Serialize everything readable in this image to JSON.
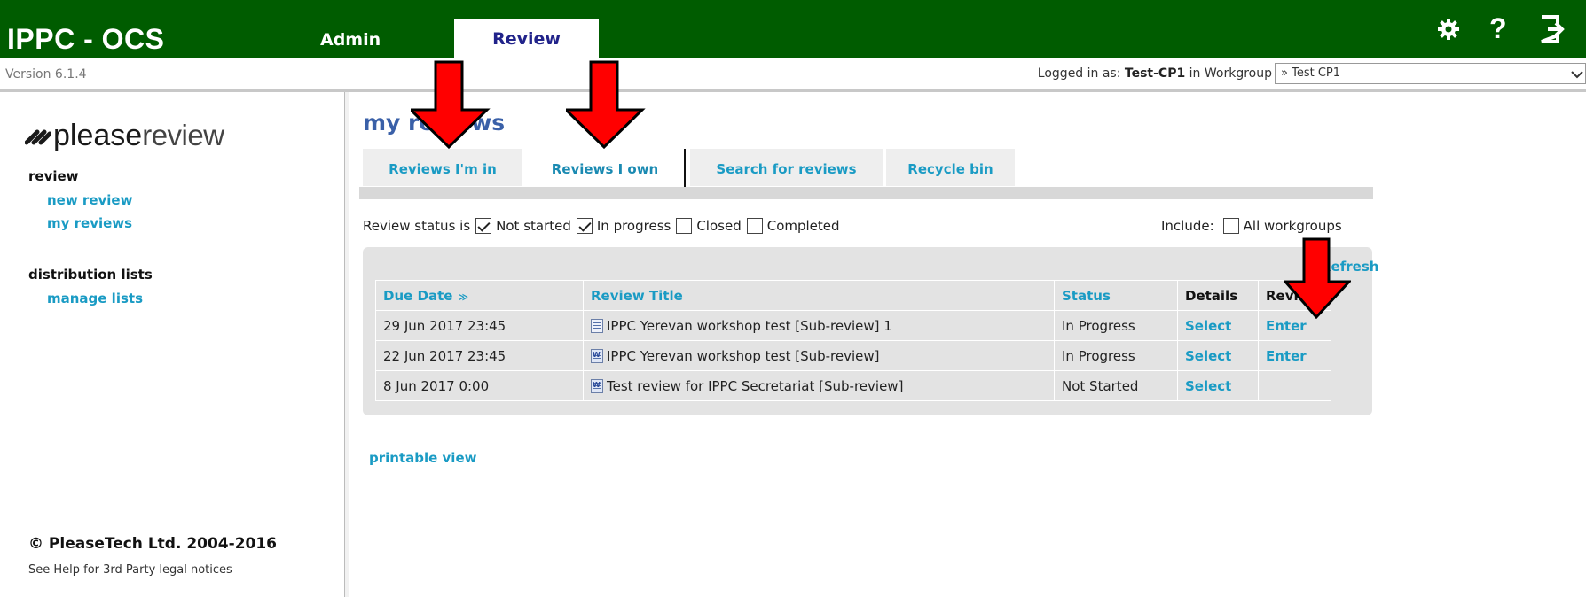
{
  "header": {
    "app_title": "IPPC - OCS",
    "nav": [
      {
        "label": "Admin",
        "active": false
      },
      {
        "label": "Review",
        "active": true
      }
    ],
    "icons": [
      "gear-icon",
      "help-icon",
      "logout-icon"
    ],
    "help_glyph": "?"
  },
  "subbar": {
    "version": "Version 6.1.4",
    "logged_in_prefix": "Logged in as: ",
    "logged_in_user": "Test-CP1",
    "workgroup_prefix": " in Workgroup",
    "workgroup_value": "» Test CP1"
  },
  "sidebar": {
    "logo_please": "please",
    "logo_review": "review",
    "sections": [
      {
        "heading": "review",
        "links": [
          "new review",
          "my reviews"
        ]
      },
      {
        "heading": "distribution lists",
        "links": [
          "manage lists"
        ]
      }
    ],
    "copyright": "© PleaseTech Ltd. 2004-2016",
    "legal": "See Help for 3rd Party legal notices"
  },
  "main": {
    "title": "my reviews",
    "tabs": [
      {
        "label": "Reviews I'm in",
        "active": false
      },
      {
        "label": "Reviews I own",
        "active": true
      },
      {
        "label": "Search for reviews",
        "active": false
      },
      {
        "label": "Recycle bin",
        "active": false
      }
    ],
    "status_label": "Review status is",
    "status_filters": [
      {
        "label": "Not started",
        "checked": true
      },
      {
        "label": "In progress",
        "checked": true
      },
      {
        "label": "Closed",
        "checked": false
      },
      {
        "label": "Completed",
        "checked": false
      }
    ],
    "include_label": "Include:",
    "include_option": {
      "label": "All workgroups",
      "checked": false
    },
    "refresh_label": "Refresh",
    "table": {
      "columns": [
        "Due Date",
        "Review Title",
        "Status",
        "Details",
        "Review"
      ],
      "rows": [
        {
          "due": "29 Jun 2017 23:45",
          "icon": "document-folder-icon",
          "title": "IPPC Yerevan workshop test [Sub-review] 1",
          "status": "In Progress",
          "details": "Select",
          "review": "Enter"
        },
        {
          "due": "22 Jun 2017 23:45",
          "icon": "word-document-icon",
          "title": "IPPC Yerevan workshop test [Sub-review]",
          "status": "In Progress",
          "details": "Select",
          "review": "Enter"
        },
        {
          "due": "8 Jun 2017 0:00",
          "icon": "word-document-icon",
          "title": "Test review for IPPC Secretariat [Sub-review]",
          "status": "Not Started",
          "details": "Select",
          "review": ""
        }
      ]
    },
    "printable_label": "printable view"
  },
  "colors": {
    "header_green": "#005c00",
    "link_blue": "#1a9bc4",
    "title_blue": "#3a60a8",
    "annotation_red": "#ff0000"
  }
}
